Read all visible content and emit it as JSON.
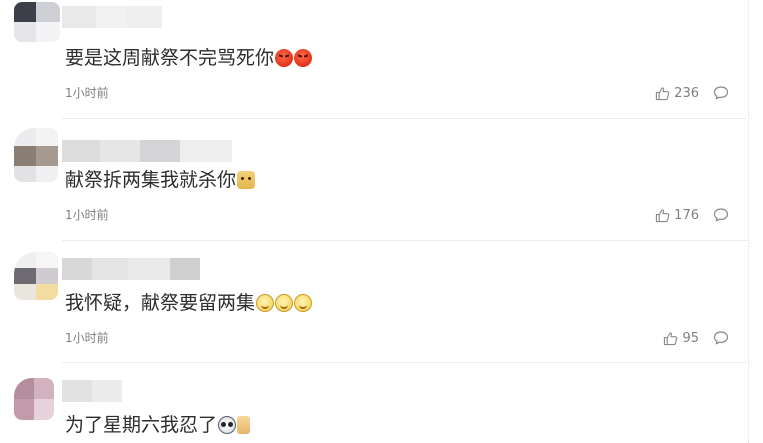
{
  "comments": [
    {
      "text": "要是这周献祭不完骂死你",
      "emojis": [
        "angry-face-emoji",
        "angry-face-emoji"
      ],
      "time": "1小时前",
      "likes": "236"
    },
    {
      "text": "献祭拆两集我就杀你",
      "emojis": [
        "doge-emoji"
      ],
      "time": "1小时前",
      "likes": "176"
    },
    {
      "text": "我怀疑，献祭要留两集",
      "emojis": [
        "awkward-smile-emoji",
        "awkward-smile-emoji",
        "awkward-smile-emoji"
      ],
      "time": "1小时前",
      "likes": "95"
    },
    {
      "text": "为了星期六我忍了",
      "emojis": [
        "panda-emoji",
        "thumbs-up-emoji"
      ],
      "time": "",
      "likes": ""
    }
  ],
  "icons": {
    "like": "thumbs-up-icon",
    "reply": "comment-bubble-icon"
  },
  "colors": {
    "text": "#2d2d2d",
    "meta": "#808080",
    "divider": "#ececec"
  }
}
